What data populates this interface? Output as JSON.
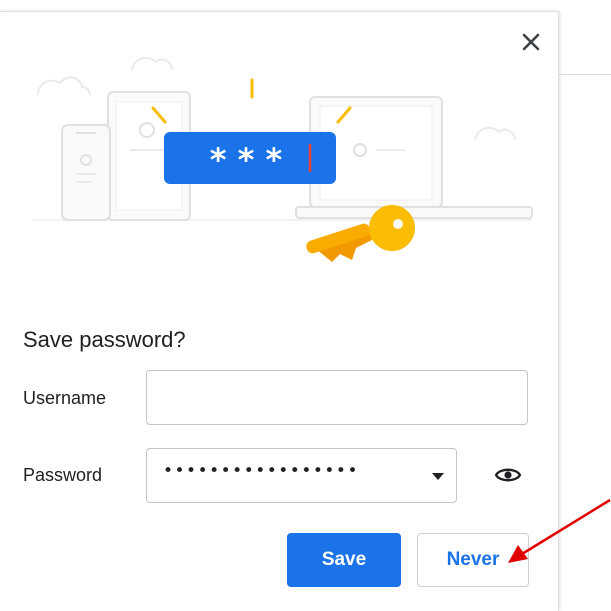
{
  "dialog": {
    "title": "Save password?",
    "close_icon": "close-icon",
    "illustration": {
      "masked_chars": "* * *",
      "key_icon": "key-icon"
    },
    "username": {
      "label": "Username",
      "value": ""
    },
    "password": {
      "label": "Password",
      "masked_value": "•••••••••••••••••",
      "toggle_icon": "eye-icon"
    },
    "buttons": {
      "save_label": "Save",
      "never_label": "Never"
    }
  },
  "colors": {
    "primary_blue": "#1a73e8",
    "key_yellow": "#fbbc04",
    "key_orange": "#f29900",
    "cursor_red": "#ea4335",
    "annotation_red": "#e00000"
  }
}
